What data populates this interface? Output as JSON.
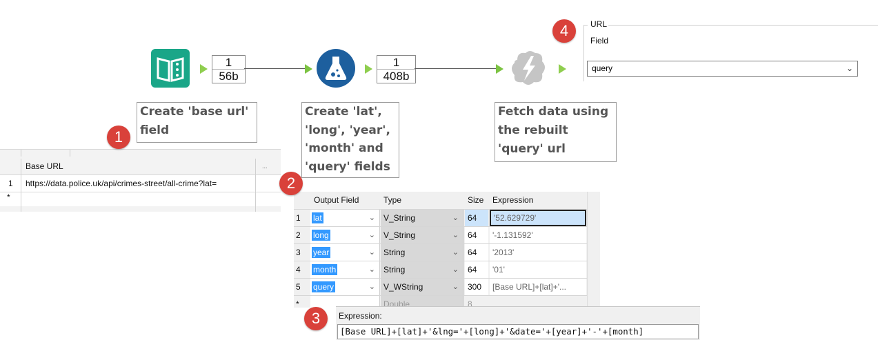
{
  "url_panel": {
    "section_title": "URL",
    "field_label": "Field",
    "field_value": "query"
  },
  "counts": [
    {
      "records": "1",
      "size": "56b"
    },
    {
      "records": "1",
      "size": "408b"
    }
  ],
  "annotations": [
    {
      "lines": [
        "Create 'base url'",
        "field"
      ]
    },
    {
      "lines": [
        "Create 'lat',",
        "'long', 'year',",
        "'month' and",
        "'query' fields"
      ]
    },
    {
      "lines": [
        "Fetch data using",
        "the rebuilt",
        "'query' url"
      ]
    }
  ],
  "steps": [
    "1",
    "2",
    "3",
    "4"
  ],
  "base_url_grid": {
    "header": "Base URL",
    "header_more": "...",
    "row_num": "1",
    "row_value": "https://data.police.uk/api/crimes-street/all-crime?lat=",
    "new_row_marker": "*"
  },
  "formula_grid": {
    "headers": [
      "Output Field",
      "Type",
      "Size",
      "Expression"
    ],
    "rows": [
      {
        "num": "1",
        "field": "lat",
        "type": "V_String",
        "size": "64",
        "expr": "'52.629729'"
      },
      {
        "num": "2",
        "field": "long",
        "type": "V_String",
        "size": "64",
        "expr": "'-1.131592'"
      },
      {
        "num": "3",
        "field": "year",
        "type": "String",
        "size": "64",
        "expr": "'2013'"
      },
      {
        "num": "4",
        "field": "month",
        "type": "String",
        "size": "64",
        "expr": "'01'"
      },
      {
        "num": "5",
        "field": "query",
        "type": "V_WString",
        "size": "300",
        "expr": "[Base URL]+[lat]+'..."
      }
    ],
    "partial_row": {
      "num": "*",
      "type": "Double",
      "size": "8"
    }
  },
  "expression_panel": {
    "label": "Expression:",
    "value": "[Base URL]+[lat]+'&lng='+[long]+'&date='+[year]+'-'+[month]"
  },
  "colors": {
    "text_input": "#1aa688",
    "formula": "#1d5f9e",
    "download": "#c5c5c5",
    "anchor": "#7cc342",
    "step_badge": "#d9413a",
    "selection": "#3399ff"
  }
}
